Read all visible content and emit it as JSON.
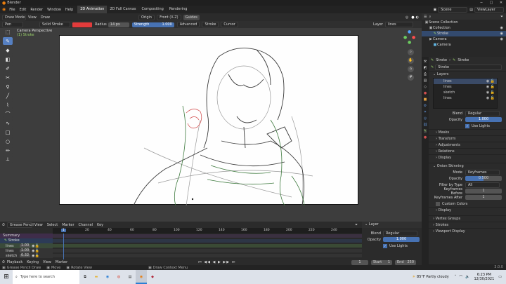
{
  "app_title": "Blender",
  "menus": [
    "File",
    "Edit",
    "Render",
    "Window",
    "Help"
  ],
  "workspaces": [
    {
      "label": "2D Animation",
      "active": true
    },
    {
      "label": "2D Full Canvas",
      "active": false
    },
    {
      "label": "Compositing",
      "active": false
    },
    {
      "label": "Rendering",
      "active": false
    }
  ],
  "mode": "Draw Mode",
  "scene": "Scene",
  "viewlayer": "ViewLayer",
  "header": {
    "view": "View",
    "draw": "Draw",
    "origin": "Origin",
    "front_label": "Front (X-Z)",
    "guides": "Guides",
    "pen": "Pen",
    "material": "Solid Stroke",
    "radius_label": "Radius",
    "radius_value": "14 px",
    "strength_label": "Strength",
    "strength_value": "1.000",
    "advanced": "Advanced",
    "stroke": "Stroke",
    "cursor": "Cursor",
    "layer_label": "Layer",
    "layer_value": "lines",
    "color": "#e23b3b"
  },
  "viewport": {
    "camera_label": "Camera Perspective",
    "object_label": "(1) Stroke"
  },
  "outliner": {
    "items": [
      {
        "label": "Scene Collection",
        "indent": 0
      },
      {
        "label": "Collection",
        "indent": 1
      },
      {
        "label": "Stroke",
        "indent": 2,
        "active": true
      },
      {
        "label": "Camera",
        "indent": 1
      },
      {
        "label": "Camera",
        "indent": 2
      }
    ]
  },
  "properties": {
    "crumbs": [
      "Stroke",
      "Stroke"
    ],
    "object_name": "Stroke",
    "layers_header": "Layers",
    "layers": [
      "lines",
      "lines",
      "sketch",
      "lines"
    ],
    "blend_label": "Blend",
    "blend_value": "Regular",
    "opacity_label": "Opacity",
    "opacity_value": "1.000",
    "use_lights": "Use Lights",
    "sections": [
      "Masks",
      "Transform",
      "Adjustments",
      "Relations",
      "Display"
    ],
    "onion": {
      "header": "Onion Skinning",
      "mode_label": "Mode",
      "mode_value": "Keyframes",
      "opacity_label": "Opacity",
      "opacity_value": "0.500",
      "filter_label": "Filter by Type",
      "filter_value": "All",
      "before_label": "Keyframes Before",
      "before_value": "1",
      "after_label": "Keyframes After",
      "after_value": "1",
      "custom_colors": "Custom Colors",
      "display": "Display"
    },
    "more_sections": [
      "Vertex Groups",
      "Strokes",
      "Viewport Display"
    ]
  },
  "timeline": {
    "mode": "Grease Pencil",
    "menus": [
      "View",
      "Select",
      "Marker",
      "Channel",
      "Key"
    ],
    "current_frame": "1",
    "ticks": [
      "1",
      "20",
      "40",
      "60",
      "80",
      "100",
      "120",
      "140",
      "160",
      "180",
      "200",
      "220",
      "240"
    ],
    "channels": [
      {
        "label": "Summary",
        "value": ""
      },
      {
        "label": "Stroke",
        "value": ""
      },
      {
        "label": "lines",
        "value": "1.00"
      },
      {
        "label": "lines",
        "value": "1.00"
      },
      {
        "label": "sketch",
        "value": "0.32"
      }
    ],
    "footer": {
      "playback": "Playback",
      "keying": "Keying",
      "view": "View",
      "marker": "Marker",
      "frame": "1",
      "start_label": "Start",
      "start": "1",
      "end_label": "End",
      "end": "250"
    }
  },
  "layer_panel": {
    "title": "Layer",
    "blend_label": "Blend",
    "blend_value": "Regular",
    "opacity_label": "Opacity",
    "opacity_value": "1.000",
    "use_lights": "Use Lights"
  },
  "status": {
    "left": "Grease Pencil Draw",
    "move": "Move",
    "rotate": "Rotate View",
    "menu": "Draw Context Menu",
    "version": "3.0.0"
  },
  "taskbar": {
    "search": "Type here to search",
    "weather": "85°F  Partly cloudy",
    "time": "6:23 PM",
    "date": "12/30/2021"
  }
}
